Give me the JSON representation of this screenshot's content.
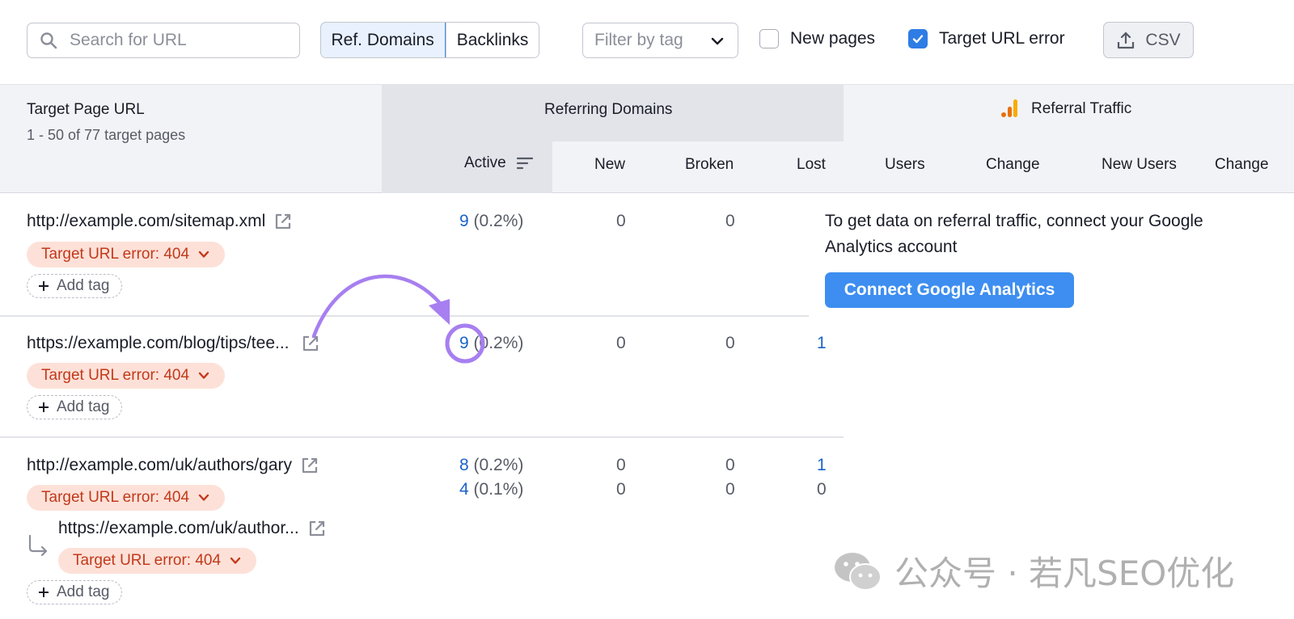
{
  "toolbar": {
    "search_placeholder": "Search for URL",
    "tabs": [
      {
        "label": "Ref. Domains",
        "active": true
      },
      {
        "label": "Backlinks",
        "active": false
      }
    ],
    "filter_placeholder": "Filter by tag",
    "new_pages": {
      "label": "New pages",
      "checked": false
    },
    "target_url_error": {
      "label": "Target URL error",
      "checked": true
    },
    "csv_label": "CSV"
  },
  "table": {
    "target_page_header": "Target Page URL",
    "range_text": "1 - 50 of 77 target pages",
    "referring_domains_header": "Referring Domains",
    "referral_traffic_header": "Referral Traffic",
    "columns": [
      "Active",
      "New",
      "Broken",
      "Lost",
      "Users",
      "Change",
      "New Users",
      "Change"
    ],
    "rows": [
      {
        "url": "http://example.com/sitemap.xml",
        "error": "Target URL error: 404",
        "add_tag": "Add tag",
        "active": "9",
        "active_pct": "(0.2%)",
        "new": "0",
        "broken": "0",
        "lost": ""
      },
      {
        "url": "https://example.com/blog/tips/tee...",
        "error": "Target URL error: 404",
        "add_tag": "Add tag",
        "active": "9",
        "active_pct": "(0.2%)",
        "new": "0",
        "broken": "0",
        "lost": "1"
      },
      {
        "url": "http://example.com/uk/authors/gary",
        "error": "Target URL error: 404",
        "add_tag": "Add tag",
        "active": "8",
        "active_pct": "(0.2%)",
        "new": "0",
        "broken": "0",
        "lost": "1",
        "child": {
          "url": "https://example.com/uk/author...",
          "error": "Target URL error: 404",
          "active": "4",
          "active_pct": "(0.1%)",
          "new": "0",
          "broken": "0",
          "lost": "0"
        }
      }
    ]
  },
  "analytics": {
    "message": "To get data on referral traffic, connect your Google Analytics account",
    "button_label": "Connect Google Analytics"
  },
  "watermark": "公众号 · 若凡SEO优化",
  "colors": {
    "accent_blue": "#1b63c9",
    "button_blue": "#3d8ef0",
    "error_bg": "#fde1d8",
    "error_text": "#c2391b",
    "annotation_purple": "#a77ff0"
  }
}
